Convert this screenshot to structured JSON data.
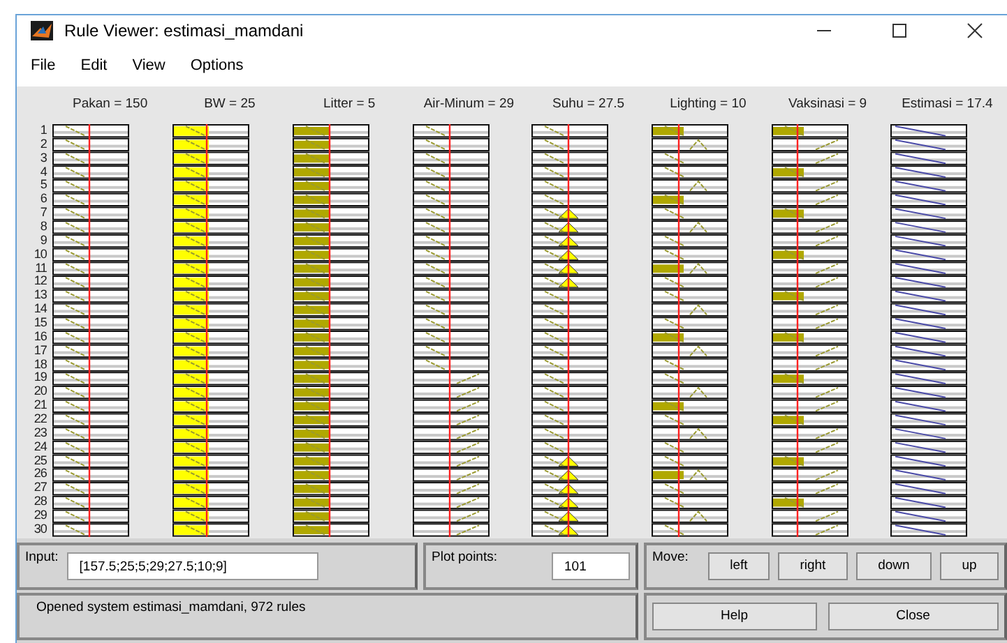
{
  "window": {
    "title": "Rule Viewer: estimasi_mamdani"
  },
  "menu": [
    "File",
    "Edit",
    "View",
    "Options"
  ],
  "variables": [
    {
      "label": "Pakan = 150",
      "kind": "input"
    },
    {
      "label": "BW = 25",
      "kind": "input"
    },
    {
      "label": "Litter = 5",
      "kind": "input"
    },
    {
      "label": "Air-Minum = 29",
      "kind": "input"
    },
    {
      "label": "Suhu = 27.5",
      "kind": "input"
    },
    {
      "label": "Lighting = 10",
      "kind": "input"
    },
    {
      "label": "Vaksinasi = 9",
      "kind": "input"
    },
    {
      "label": "Estimasi = 17.4",
      "kind": "output"
    }
  ],
  "rule_numbers": [
    "1",
    "2",
    "3",
    "4",
    "5",
    "6",
    "7",
    "8",
    "9",
    "10",
    "11",
    "12",
    "13",
    "14",
    "15",
    "16",
    "17",
    "18",
    "19",
    "20",
    "21",
    "22",
    "23",
    "24",
    "25",
    "26",
    "27",
    "28",
    "29",
    "30"
  ],
  "input": {
    "label": "Input:",
    "value": "[157.5;25;5;29;27.5;10;9]"
  },
  "plot_points": {
    "label": "Plot points:",
    "value": "101"
  },
  "move": {
    "label": "Move:",
    "buttons": [
      "left",
      "right",
      "down",
      "up"
    ]
  },
  "status": "Opened system estimasi_mamdani, 972 rules",
  "buttons": [
    "Help",
    "Close"
  ]
}
